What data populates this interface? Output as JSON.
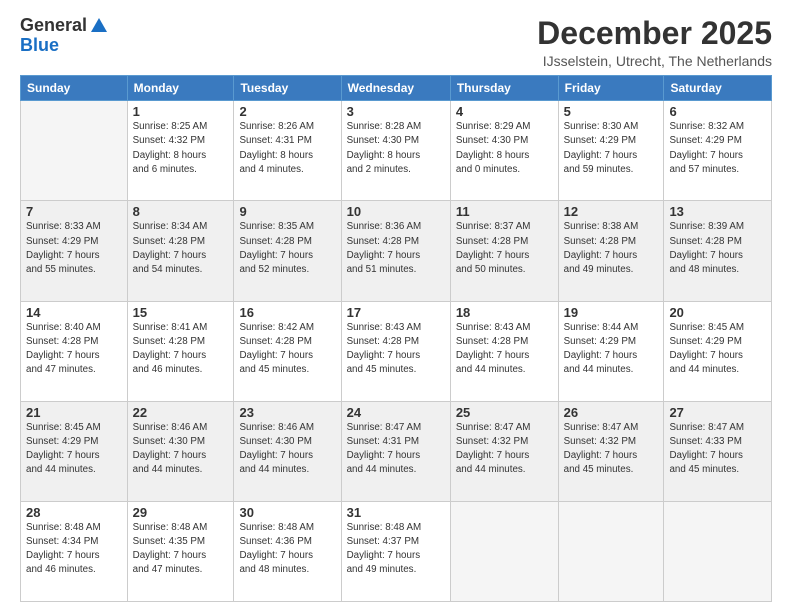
{
  "logo": {
    "general": "General",
    "blue": "Blue",
    "tagline": "GeneralBlue"
  },
  "title": "December 2025",
  "location": "IJsselstein, Utrecht, The Netherlands",
  "days_header": [
    "Sunday",
    "Monday",
    "Tuesday",
    "Wednesday",
    "Thursday",
    "Friday",
    "Saturday"
  ],
  "weeks": [
    [
      {
        "day": "",
        "info": ""
      },
      {
        "day": "1",
        "info": "Sunrise: 8:25 AM\nSunset: 4:32 PM\nDaylight: 8 hours\nand 6 minutes."
      },
      {
        "day": "2",
        "info": "Sunrise: 8:26 AM\nSunset: 4:31 PM\nDaylight: 8 hours\nand 4 minutes."
      },
      {
        "day": "3",
        "info": "Sunrise: 8:28 AM\nSunset: 4:30 PM\nDaylight: 8 hours\nand 2 minutes."
      },
      {
        "day": "4",
        "info": "Sunrise: 8:29 AM\nSunset: 4:30 PM\nDaylight: 8 hours\nand 0 minutes."
      },
      {
        "day": "5",
        "info": "Sunrise: 8:30 AM\nSunset: 4:29 PM\nDaylight: 7 hours\nand 59 minutes."
      },
      {
        "day": "6",
        "info": "Sunrise: 8:32 AM\nSunset: 4:29 PM\nDaylight: 7 hours\nand 57 minutes."
      }
    ],
    [
      {
        "day": "7",
        "info": "Sunrise: 8:33 AM\nSunset: 4:29 PM\nDaylight: 7 hours\nand 55 minutes."
      },
      {
        "day": "8",
        "info": "Sunrise: 8:34 AM\nSunset: 4:28 PM\nDaylight: 7 hours\nand 54 minutes."
      },
      {
        "day": "9",
        "info": "Sunrise: 8:35 AM\nSunset: 4:28 PM\nDaylight: 7 hours\nand 52 minutes."
      },
      {
        "day": "10",
        "info": "Sunrise: 8:36 AM\nSunset: 4:28 PM\nDaylight: 7 hours\nand 51 minutes."
      },
      {
        "day": "11",
        "info": "Sunrise: 8:37 AM\nSunset: 4:28 PM\nDaylight: 7 hours\nand 50 minutes."
      },
      {
        "day": "12",
        "info": "Sunrise: 8:38 AM\nSunset: 4:28 PM\nDaylight: 7 hours\nand 49 minutes."
      },
      {
        "day": "13",
        "info": "Sunrise: 8:39 AM\nSunset: 4:28 PM\nDaylight: 7 hours\nand 48 minutes."
      }
    ],
    [
      {
        "day": "14",
        "info": "Sunrise: 8:40 AM\nSunset: 4:28 PM\nDaylight: 7 hours\nand 47 minutes."
      },
      {
        "day": "15",
        "info": "Sunrise: 8:41 AM\nSunset: 4:28 PM\nDaylight: 7 hours\nand 46 minutes."
      },
      {
        "day": "16",
        "info": "Sunrise: 8:42 AM\nSunset: 4:28 PM\nDaylight: 7 hours\nand 45 minutes."
      },
      {
        "day": "17",
        "info": "Sunrise: 8:43 AM\nSunset: 4:28 PM\nDaylight: 7 hours\nand 45 minutes."
      },
      {
        "day": "18",
        "info": "Sunrise: 8:43 AM\nSunset: 4:28 PM\nDaylight: 7 hours\nand 44 minutes."
      },
      {
        "day": "19",
        "info": "Sunrise: 8:44 AM\nSunset: 4:29 PM\nDaylight: 7 hours\nand 44 minutes."
      },
      {
        "day": "20",
        "info": "Sunrise: 8:45 AM\nSunset: 4:29 PM\nDaylight: 7 hours\nand 44 minutes."
      }
    ],
    [
      {
        "day": "21",
        "info": "Sunrise: 8:45 AM\nSunset: 4:29 PM\nDaylight: 7 hours\nand 44 minutes."
      },
      {
        "day": "22",
        "info": "Sunrise: 8:46 AM\nSunset: 4:30 PM\nDaylight: 7 hours\nand 44 minutes."
      },
      {
        "day": "23",
        "info": "Sunrise: 8:46 AM\nSunset: 4:30 PM\nDaylight: 7 hours\nand 44 minutes."
      },
      {
        "day": "24",
        "info": "Sunrise: 8:47 AM\nSunset: 4:31 PM\nDaylight: 7 hours\nand 44 minutes."
      },
      {
        "day": "25",
        "info": "Sunrise: 8:47 AM\nSunset: 4:32 PM\nDaylight: 7 hours\nand 44 minutes."
      },
      {
        "day": "26",
        "info": "Sunrise: 8:47 AM\nSunset: 4:32 PM\nDaylight: 7 hours\nand 45 minutes."
      },
      {
        "day": "27",
        "info": "Sunrise: 8:47 AM\nSunset: 4:33 PM\nDaylight: 7 hours\nand 45 minutes."
      }
    ],
    [
      {
        "day": "28",
        "info": "Sunrise: 8:48 AM\nSunset: 4:34 PM\nDaylight: 7 hours\nand 46 minutes."
      },
      {
        "day": "29",
        "info": "Sunrise: 8:48 AM\nSunset: 4:35 PM\nDaylight: 7 hours\nand 47 minutes."
      },
      {
        "day": "30",
        "info": "Sunrise: 8:48 AM\nSunset: 4:36 PM\nDaylight: 7 hours\nand 48 minutes."
      },
      {
        "day": "31",
        "info": "Sunrise: 8:48 AM\nSunset: 4:37 PM\nDaylight: 7 hours\nand 49 minutes."
      },
      {
        "day": "",
        "info": ""
      },
      {
        "day": "",
        "info": ""
      },
      {
        "day": "",
        "info": ""
      }
    ]
  ]
}
